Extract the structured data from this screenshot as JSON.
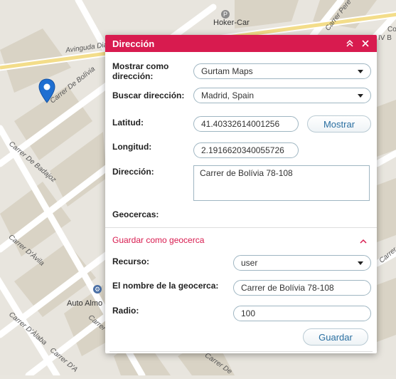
{
  "map": {
    "labels": [
      {
        "name": "street-avinguda-diagonal",
        "text": "Avinguda Diagonal"
      },
      {
        "name": "street-carrer-de-bolivia",
        "text": "Carrer De Bolívia"
      },
      {
        "name": "poi-hoker-car",
        "text": "Hoker-Car"
      },
      {
        "name": "street-carrer-de-badajoz",
        "text": "Carrer De Badajoz"
      },
      {
        "name": "street-carrer-davila",
        "text": "Carrer D'Àvila"
      },
      {
        "name": "poi-auto-almo",
        "text": "Auto Almo"
      },
      {
        "name": "street-carrer-dalaba",
        "text": "Carrer D'Àlaba"
      },
      {
        "name": "street-carrer-pere",
        "text": "Carrer Pere"
      },
      {
        "name": "street-carrer-fragment-1",
        "text": "Carrer"
      },
      {
        "name": "street-carrer-fragment-2",
        "text": "Carrer D'A"
      },
      {
        "name": "street-carrer-fragment-3",
        "text": "Carrer De"
      },
      {
        "name": "street-edge-co",
        "text": "Co"
      },
      {
        "name": "street-edge-b",
        "text": "IV B"
      },
      {
        "name": "street-edge-de",
        "text": "Carrer De"
      }
    ]
  },
  "dialog": {
    "title": "Dirección",
    "colors": {
      "header": "#d81b4f",
      "accent_text": "#d81b4f",
      "button_text": "#2a6fa1"
    },
    "mostrar_como": {
      "label": "Mostrar como dirección:",
      "value": "Gurtam Maps"
    },
    "buscar": {
      "label": "Buscar dirección:",
      "value": "Madrid, Spain"
    },
    "latitud": {
      "label": "Latitud:",
      "value": "41.40332614001256"
    },
    "mostrar_button": "Mostrar",
    "longitud": {
      "label": "Longitud:",
      "value": "2.1916620340055726"
    },
    "direccion": {
      "label": "Dirección:",
      "value": "Carrer de Bolívia 78-108"
    },
    "geocercas_label": "Geocercas:",
    "section": {
      "title": "Guardar como geocerca",
      "recurso": {
        "label": "Recurso:",
        "value": "user"
      },
      "nombre": {
        "label": "El nombre de la geocerca:",
        "value": "Carrer de Bolívia 78-108"
      },
      "radio": {
        "label": "Radio:",
        "value": "100"
      },
      "guardar_button": "Guardar"
    }
  }
}
